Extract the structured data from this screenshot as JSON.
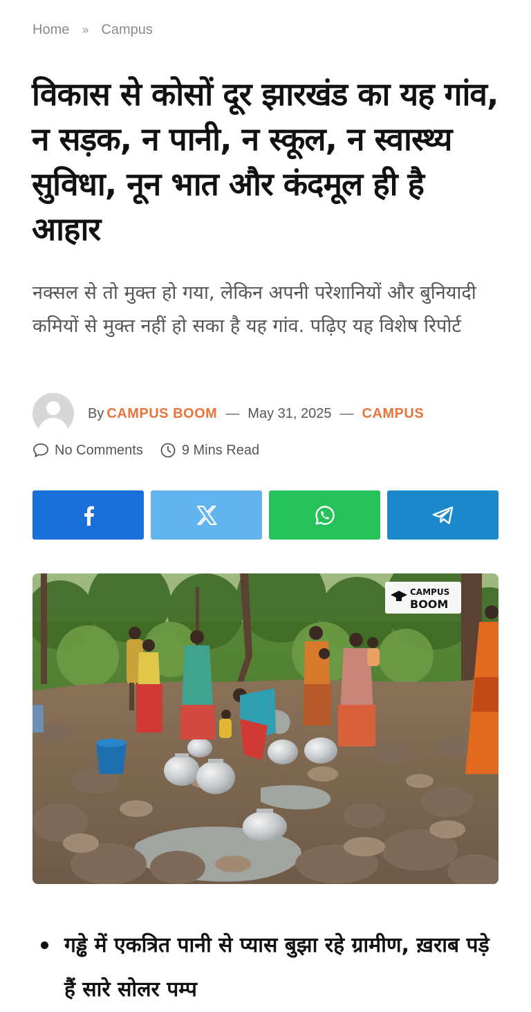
{
  "breadcrumb": {
    "home": "Home",
    "separator": "»",
    "current": "Campus"
  },
  "article": {
    "title": "विकास से कोसों दूर झारखंड का यह गांव, न सड़क, न पानी, न स्कूल, न स्वास्थ्य सुविधा, नून भात और कंदमूल ही है आहार",
    "subtitle": "नक्सल से तो मुक्त हो गया, लेकिन अपनी परेशानियों और बुनियादी कमियों से मुक्त नहीं हो सका है यह गांव. पढ़िए यह विशेष रिपोर्ट"
  },
  "meta": {
    "by": "By",
    "author": "CAMPUS BOOM",
    "dash": "—",
    "date": "May 31, 2025",
    "category": "CAMPUS",
    "comments": "No Comments",
    "read_time": "9 Mins Read"
  },
  "share": {
    "buttons": [
      {
        "name": "facebook",
        "color": "#1b6fd8",
        "icon": "facebook-icon"
      },
      {
        "name": "x",
        "color": "#63b4ee",
        "icon": "x-icon"
      },
      {
        "name": "whatsapp",
        "color": "#25c25a",
        "icon": "whatsapp-icon"
      },
      {
        "name": "telegram",
        "color": "#1b88cc",
        "icon": "telegram-icon"
      }
    ]
  },
  "hero": {
    "watermark_line1": "CAMPUS",
    "watermark_line2": "BOOM"
  },
  "bullets": [
    "गड्ढे में एकत्रित पानी से प्यास बुझा रहे ग्रामीण, ख़राब पड़े हैं सारे सोलर पम्प"
  ],
  "colors": {
    "accent": "#e8743b",
    "text_muted": "#555555"
  }
}
